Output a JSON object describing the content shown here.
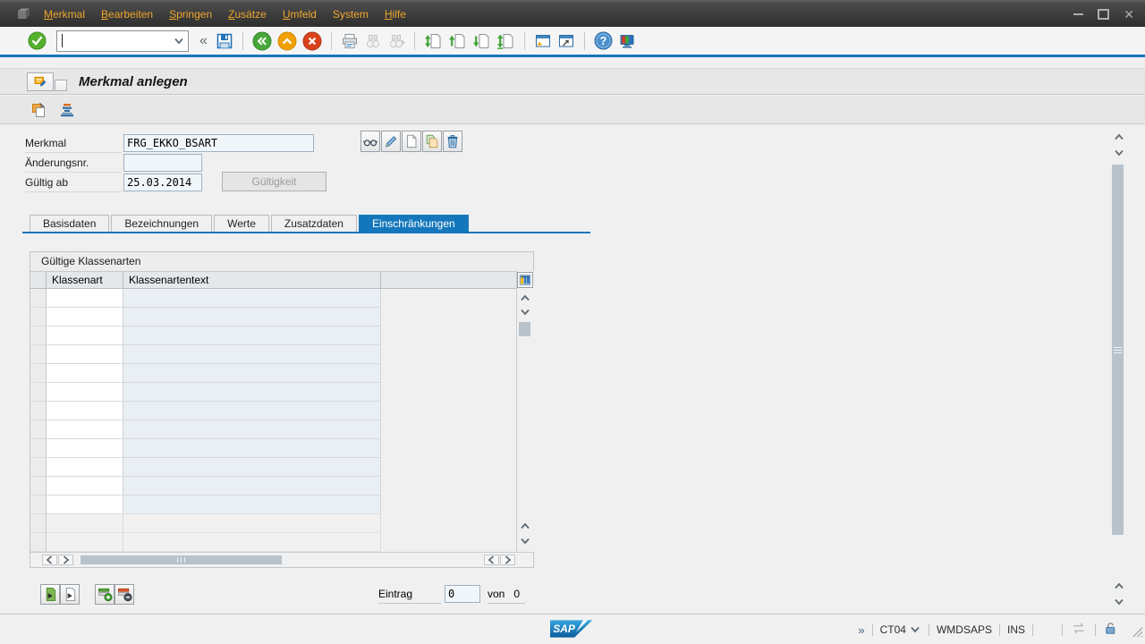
{
  "titlebar": {
    "menu_items": [
      {
        "label": "Merkmal",
        "mnemonic": 0
      },
      {
        "label": "Bearbeiten",
        "mnemonic": 0
      },
      {
        "label": "Springen",
        "mnemonic": 0
      },
      {
        "label": "Zusätze",
        "mnemonic": 0
      },
      {
        "label": "Umfeld",
        "mnemonic": 0
      },
      {
        "label": "System",
        "mnemonic": -1
      },
      {
        "label": "Hilfe",
        "mnemonic": 0
      }
    ]
  },
  "toolbar": {
    "command_value": "",
    "collapse_glyph": "«",
    "buttons": [
      "enter",
      "save",
      "back",
      "exit",
      "cancel",
      "print",
      "find",
      "find-next",
      "first-page",
      "page-up",
      "page-down",
      "last-page",
      "new-session",
      "create-shortcut",
      "help",
      "customize-local-layout"
    ]
  },
  "header": {
    "title": "Merkmal anlegen"
  },
  "app_toolbar": {
    "buttons": [
      "copy-template",
      "sort-hierarchy"
    ]
  },
  "form": {
    "merkmal_label": "Merkmal",
    "merkmal_value": "FRG_EKKO_BSART",
    "aenderungsnr_label": "Änderungsnr.",
    "aenderungsnr_value": "",
    "gueltig_ab_label": "Gültig ab",
    "gueltig_ab_value": "25.03.2014",
    "gueltigkeit_button": "Gültigkeit",
    "field_action_buttons": [
      "display",
      "change",
      "create",
      "copy",
      "delete"
    ]
  },
  "tabs": [
    {
      "label": "Basisdaten",
      "active": false
    },
    {
      "label": "Bezeichnungen",
      "active": false
    },
    {
      "label": "Werte",
      "active": false
    },
    {
      "label": "Zusatzdaten",
      "active": false
    },
    {
      "label": "Einschränkungen",
      "active": true
    }
  ],
  "klassenarten": {
    "group_title": "Gültige Klassenarten",
    "columns": [
      "Klassenart",
      "Klassenartentext"
    ],
    "visible_rows": 12,
    "disabled_rows": 2,
    "action_buttons": [
      "select-all",
      "deselect-all",
      "insert-row",
      "delete-row"
    ]
  },
  "entry_footer": {
    "eintrag_label": "Eintrag",
    "eintrag_value": "0",
    "von_label": "von",
    "total_value": "0"
  },
  "statusbar": {
    "overflow_glyph": "»",
    "transaction": "CT04",
    "system": "WMDSAPS",
    "insert_mode": "INS",
    "sap_logo_text": "SAP"
  },
  "colors": {
    "accent_blue": "#1577bb",
    "menu_text": "#efa62b",
    "scrollbar_thumb": "#b7c2cb",
    "input_bg": "#f1f6fa",
    "readonly_cell_bg": "#eaeff4"
  }
}
